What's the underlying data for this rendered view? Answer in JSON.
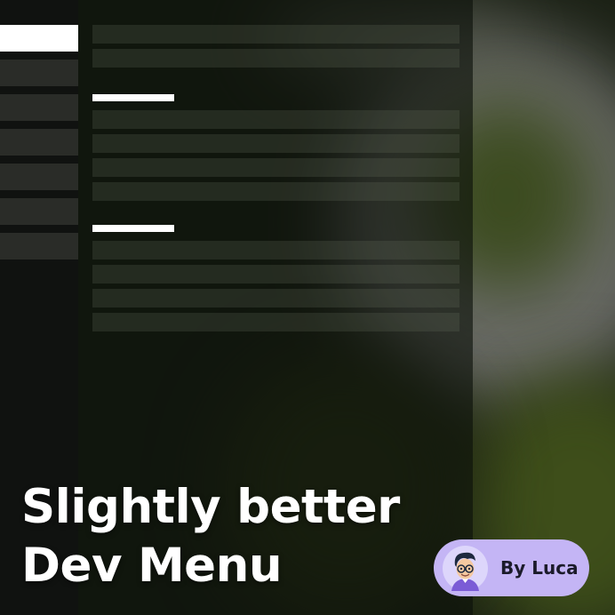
{
  "title": {
    "line1": "Slightly better",
    "line2": "Dev Menu"
  },
  "author": {
    "label": "By Luca",
    "avatar_icon": "cartoon-avatar-icon"
  },
  "menu": {
    "category_count": 7,
    "active_category": 0,
    "sections": [
      {
        "rows": 2,
        "has_header": false
      },
      {
        "rows": 4,
        "has_header": true
      },
      {
        "rows": 4,
        "has_header": true
      }
    ]
  },
  "colors": {
    "accent_badge": "#c4b5f5",
    "active_item": "#ffffff"
  }
}
